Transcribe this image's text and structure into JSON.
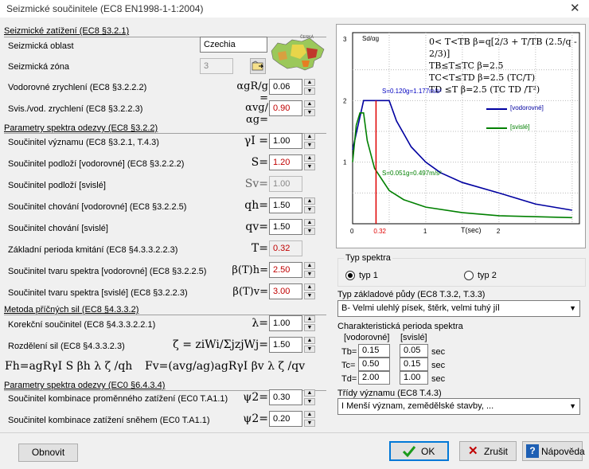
{
  "window": {
    "title": "Seizmické součinitele (EC8 EN1998-1-1:2004)",
    "close_glyph": "✕"
  },
  "left": {
    "sec_zatizeni": "Seizmické zatížení (EC8 §3.2.1)",
    "oblast_label": "Seizmická oblast",
    "oblast_value": "Czechia",
    "zona_label": "Seizmická zóna",
    "zona_value": "3",
    "vodorovne_label": "Vodorovné zrychlení (EC8 §3.2.2.2)",
    "vodorovne_sym": "αgR/g =",
    "vodorovne_value": "0.06",
    "svis_label": "Svis./vod. zrychlení (EC8 §3.2.2.3)",
    "svis_sym": "αvg/αg=",
    "svis_value": "0.90",
    "sec_spektrum": "Parametry spektra odezvy (EC8 §3.2.2)",
    "vyznam_label": "Součinitel významu (EC8 §3.2.1, T.4.3)",
    "vyznam_sym": "γI =",
    "vyznam_value": "1.00",
    "podlozi_v_label": "Součinitel podloží [vodorovné] (EC8 §3.2.2.2)",
    "podlozi_v_sym": "S=",
    "podlozi_v_value": "1.20",
    "podlozi_s_label": "Součinitel podloží [svislé]",
    "podlozi_s_sym": "Sv=",
    "podlozi_s_value": "1.00",
    "chovani_v_label": "Součinitel chování [vodorovné] (EC8 §3.2.2.5)",
    "chovani_v_sym": "qh=",
    "chovani_v_value": "1.50",
    "chovani_s_label": "Součinitel chování [svislé]",
    "chovani_s_sym": "qv=",
    "chovani_s_value": "1.50",
    "perioda_label": "Základní perioda kmitání (EC8 §4.3.3.2.2.3)",
    "perioda_sym": "T=",
    "perioda_value": "0.32",
    "tvar_v_label": "Součinitel tvaru spektra [vodorovné] (EC8 §3.2.2.5)",
    "tvar_v_sym": "β(T)h=",
    "tvar_v_value": "2.50",
    "tvar_s_label": "Součinitel tvaru spektra [svislé] (EC8 §3.2.2.3)",
    "tvar_s_sym": "β(T)v=",
    "tvar_s_value": "3.00",
    "sec_metoda": "Metoda příčných sil (EC8 §4.3.3.2)",
    "korekce_label": "Korekční součinitel  (EC8 §4.3.3.2.2.1)",
    "korekce_sym": "λ=",
    "korekce_value": "1.00",
    "rozdeleni_label": "Rozdělení sil (EC8 §4.3.3.2.3)",
    "rozdeleni_sym": "ζ = ziWi/ΣjzjWj=",
    "rozdeleni_value": "1.50",
    "formula_fh": "Fh=agRγI S βh λ ζ /qh",
    "formula_fv": "Fv=(avg/ag)agRγI βv λ ζ /qv",
    "sec_ec0": "Parametry spektra odezvy (EC0 §6.4.3.4)",
    "kombinace_label": "Součinitel kombinace proměnného zatížení (EC0 T.A1.1)",
    "kombinace_sym": "ψ2=",
    "kombinace_value": "0.30",
    "snih_label": "Součinitel kombinace zatížení sněhem (EC0 T.A1.1)",
    "snih_sym": "ψ2=",
    "snih_value": "0.20"
  },
  "chart": {
    "ylabel": "Sd/αg",
    "xlabel": "T(sec)",
    "y_ticks": [
      "3",
      "2",
      "1"
    ],
    "x_ticks": [
      "0",
      "0.32",
      "1",
      "2"
    ],
    "formulas": [
      "0< T<TB    β=q[2/3 + T/TB (2.5/q - 2/3)]",
      "TB≤T≤TC    β=2.5",
      "TC<T≤TD    β=2.5 (TC/T)",
      "TD ≤T       β=2.5 (TC TD /T²)"
    ],
    "annot_h": "S=0.120g=1.177m/s²",
    "annot_v": "S=0.051g=0.497m/s²",
    "legend_h": "[vodorovné]",
    "legend_v": "[svislé]",
    "color_h": "#0000a0",
    "color_v": "#008000",
    "color_t": "#e00000"
  },
  "chart_data": {
    "type": "line",
    "xlabel": "T(sec)",
    "ylabel": "Sd/αg",
    "xlim": [
      0,
      3.1
    ],
    "ylim": [
      0,
      3
    ],
    "marker_T": 0.32,
    "series": [
      {
        "name": "[vodorovné]",
        "x": [
          0,
          0.15,
          0.2,
          0.5,
          0.6,
          0.8,
          1.0,
          1.2,
          1.5,
          2.0,
          2.5,
          3.0
        ],
        "y": [
          1.2,
          2.0,
          2.0,
          2.0,
          1.67,
          1.25,
          1.0,
          0.83,
          0.67,
          0.5,
          0.32,
          0.22
        ]
      },
      {
        "name": "[svislé]",
        "x": [
          0,
          0.05,
          0.1,
          0.15,
          0.2,
          0.3,
          0.5,
          0.7,
          1.0,
          1.5,
          2.0,
          3.0
        ],
        "y": [
          1.0,
          1.6,
          1.8,
          1.8,
          1.35,
          0.9,
          0.54,
          0.39,
          0.27,
          0.18,
          0.13,
          0.1
        ]
      }
    ]
  },
  "right": {
    "typ_spektra_label": "Typ spektra",
    "typ1": "typ 1",
    "typ2": "typ 2",
    "pudy_label": "Typ základové půdy (EC8 T.3.2, T.3.3)",
    "pudy_value": "B- Velmi ulehlý písek, štěrk, velmi tuhý jíl",
    "perioda_label": "Charakteristická perioda spektra",
    "col_v": "[vodorovné]",
    "col_s": "[svislé]",
    "tb_label": "Tb=",
    "tb_v": "0.15",
    "tb_s": "0.05",
    "tc_label": "Tc=",
    "tc_v": "0.50",
    "tc_s": "0.15",
    "td_label": "Td=",
    "td_v": "2.00",
    "td_s": "1.00",
    "sec_unit": "sec",
    "tridy_label": "Třídy významu (EC8 T.4.3)",
    "tridy_value": "I Menší význam, zemědělské stavby, ..."
  },
  "buttons": {
    "obnovit": "Obnovit",
    "ok": "OK",
    "zrusit": "Zrušit",
    "napoveda": "Nápověda"
  }
}
